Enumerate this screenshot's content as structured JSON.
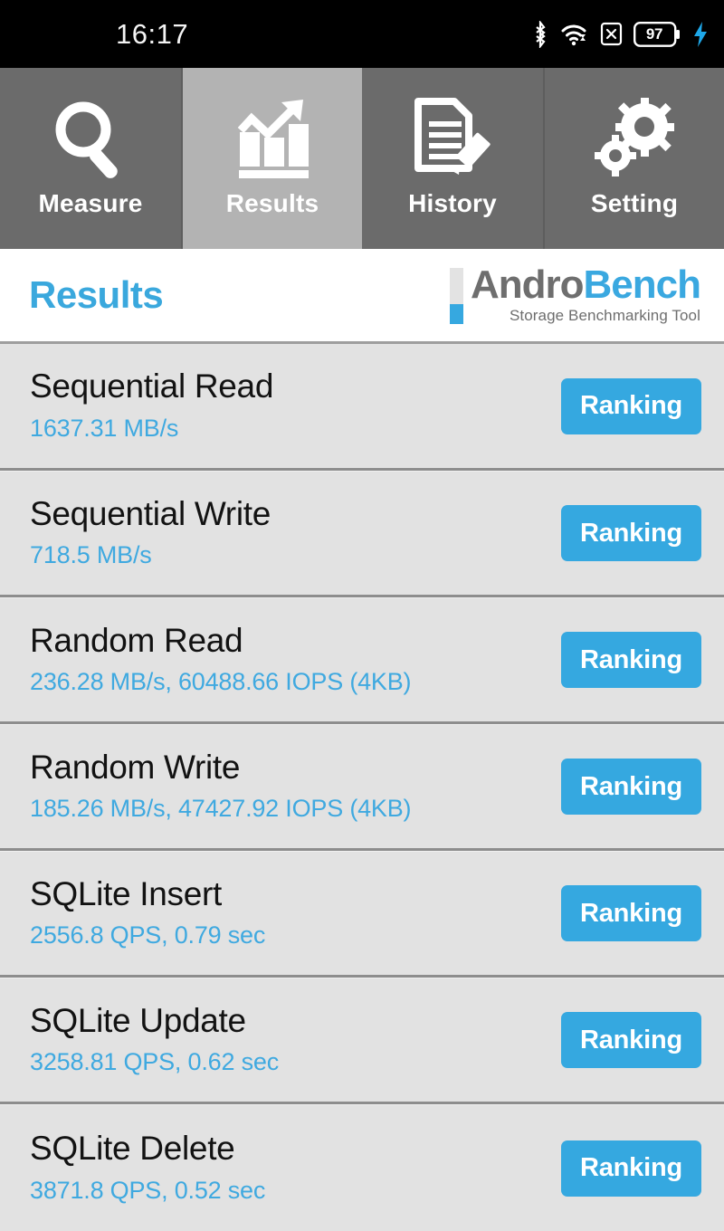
{
  "statusbar": {
    "time": "16:17",
    "battery_percent": "97",
    "icons": [
      "bluetooth-icon",
      "wifi-icon",
      "sim-x-icon",
      "battery-icon",
      "charging-bolt-icon"
    ]
  },
  "tabs": [
    {
      "label": "Measure",
      "icon": "magnifier-icon",
      "active": false
    },
    {
      "label": "Results",
      "icon": "bar-chart-arrow-icon",
      "active": true
    },
    {
      "label": "History",
      "icon": "document-pencil-icon",
      "active": false
    },
    {
      "label": "Setting",
      "icon": "gears-icon",
      "active": false
    }
  ],
  "header": {
    "title": "Results",
    "logo_andro": "Andro",
    "logo_bench": "Bench",
    "logo_tagline": "Storage Benchmarking Tool"
  },
  "results": {
    "ranking_label": "Ranking",
    "rows": [
      {
        "title": "Sequential Read",
        "value": "1637.31 MB/s"
      },
      {
        "title": "Sequential Write",
        "value": "718.5 MB/s"
      },
      {
        "title": "Random Read",
        "value": "236.28 MB/s, 60488.66 IOPS (4KB)"
      },
      {
        "title": "Random Write",
        "value": "185.26 MB/s, 47427.92 IOPS (4KB)"
      },
      {
        "title": "SQLite Insert",
        "value": "2556.8 QPS, 0.79 sec"
      },
      {
        "title": "SQLite Update",
        "value": "3258.81 QPS, 0.62 sec"
      },
      {
        "title": "SQLite Delete",
        "value": "3871.8 QPS, 0.52 sec"
      }
    ]
  },
  "colors": {
    "accent": "#35a8e0",
    "statusbar_bg": "#000000",
    "tab_inactive_bg": "#6b6b6b",
    "tab_active_bg": "#b3b3b3",
    "row_bg": "#e2e2e2",
    "row_title": "#121212"
  }
}
